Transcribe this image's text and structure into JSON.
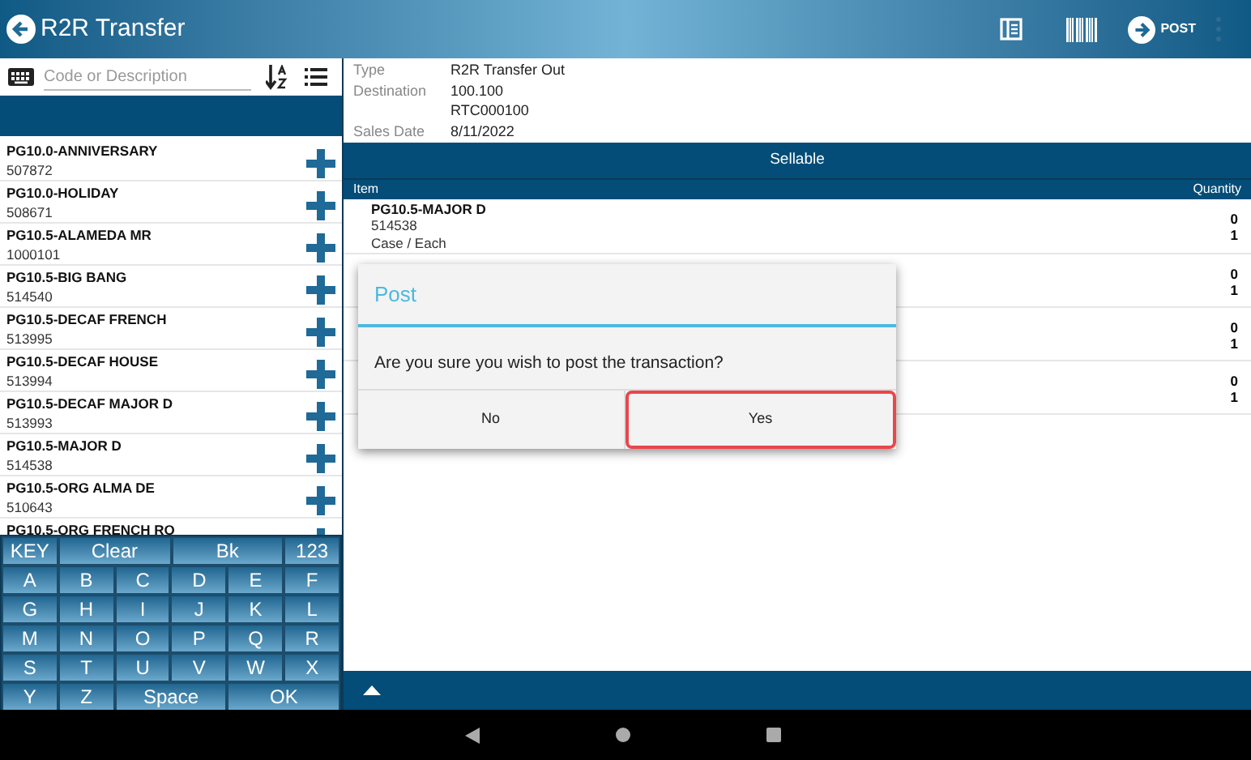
{
  "header": {
    "title": "R2R Transfer",
    "post_label": "POST"
  },
  "search": {
    "placeholder": "Code or Description"
  },
  "products": [
    {
      "name": "PG10.0-ANNIVERSARY",
      "code": "507872"
    },
    {
      "name": "PG10.0-HOLIDAY",
      "code": "508671"
    },
    {
      "name": "PG10.5-ALAMEDA MR",
      "code": "1000101"
    },
    {
      "name": "PG10.5-BIG BANG",
      "code": "514540"
    },
    {
      "name": "PG10.5-DECAF FRENCH",
      "code": "513995"
    },
    {
      "name": "PG10.5-DECAF HOUSE",
      "code": "513994"
    },
    {
      "name": "PG10.5-DECAF MAJOR D",
      "code": "513993"
    },
    {
      "name": "PG10.5-MAJOR D",
      "code": "514538"
    },
    {
      "name": "PG10.5-ORG  ALMA DE",
      "code": "510643"
    },
    {
      "name": "PG10.5-ORG FRENCH RO"
    }
  ],
  "keyboard": [
    [
      {
        "label": "KEY",
        "kind": "key"
      },
      {
        "label": "Clear",
        "kind": "wide"
      },
      {
        "label": "Bk",
        "kind": "wide"
      },
      {
        "label": "123",
        "kind": "key"
      }
    ],
    [
      {
        "label": "A",
        "kind": "key"
      },
      {
        "label": "B",
        "kind": "key"
      },
      {
        "label": "C",
        "kind": "key"
      },
      {
        "label": "D",
        "kind": "key"
      },
      {
        "label": "E",
        "kind": "key"
      },
      {
        "label": "F",
        "kind": "key"
      }
    ],
    [
      {
        "label": "G",
        "kind": "key"
      },
      {
        "label": "H",
        "kind": "key"
      },
      {
        "label": "I",
        "kind": "key"
      },
      {
        "label": "J",
        "kind": "key"
      },
      {
        "label": "K",
        "kind": "key"
      },
      {
        "label": "L",
        "kind": "key"
      }
    ],
    [
      {
        "label": "M",
        "kind": "key"
      },
      {
        "label": "N",
        "kind": "key"
      },
      {
        "label": "O",
        "kind": "key"
      },
      {
        "label": "P",
        "kind": "key"
      },
      {
        "label": "Q",
        "kind": "key"
      },
      {
        "label": "R",
        "kind": "key"
      }
    ],
    [
      {
        "label": "S",
        "kind": "key"
      },
      {
        "label": "T",
        "kind": "key"
      },
      {
        "label": "U",
        "kind": "key"
      },
      {
        "label": "V",
        "kind": "key"
      },
      {
        "label": "W",
        "kind": "key"
      },
      {
        "label": "X",
        "kind": "key"
      }
    ],
    [
      {
        "label": "Y",
        "kind": "key"
      },
      {
        "label": "Z",
        "kind": "key"
      },
      {
        "label": "Space",
        "kind": "wide"
      },
      {
        "label": "OK",
        "kind": "wide"
      }
    ]
  ],
  "details": [
    {
      "label": "Type",
      "value": "R2R Transfer Out"
    },
    {
      "label": "Destination",
      "value": "100.100"
    },
    {
      "value": "RTC000100"
    },
    {
      "label": "Sales Date",
      "value": "8/11/2022"
    }
  ],
  "table": {
    "title": "Sellable",
    "columns": [
      "Item",
      "Quantity"
    ],
    "rows": [
      {
        "name": "PG10.5-MAJOR D",
        "code": "514538",
        "unit": "Case / Each",
        "quantities": [
          "0",
          "1"
        ]
      },
      {
        "quantities": [
          "0",
          "1"
        ]
      },
      {
        "quantities": [
          "0",
          "1"
        ]
      },
      {
        "quantities": [
          "0",
          "1"
        ]
      }
    ]
  },
  "dialog": {
    "title": "Post",
    "message": "Are you sure you wish to post the transaction?",
    "buttons": [
      {
        "label": "No",
        "selected": false
      },
      {
        "label": "Yes",
        "selected": true
      }
    ]
  }
}
